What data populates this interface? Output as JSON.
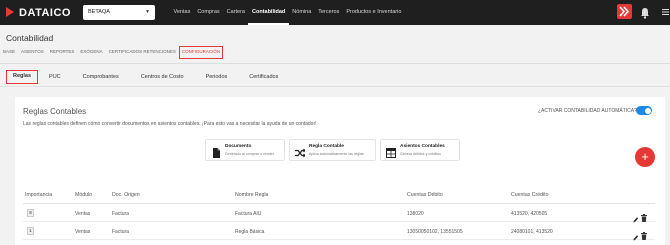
{
  "topbar": {
    "logo": "DATAICO",
    "company": "BETAQA",
    "nav": [
      "Ventas",
      "Compras",
      "Cartera",
      "Contabilidad",
      "Nómina",
      "Terceros",
      "Productos e Inventario"
    ],
    "active_index": 3,
    "icons": {
      "brand": "chevrons-right-icon",
      "bell": "bell-icon",
      "menu": "kebab-menu-icon"
    }
  },
  "page": {
    "title": "Contabilidad"
  },
  "subnav": [
    "BASE",
    "ASIENTOS",
    "REPORTES",
    "EXÓGENA",
    "CERTIFICADOS RETENCIONES",
    "CONFIGURACIÓN"
  ],
  "tabs": [
    "Reglas",
    "PUC",
    "Comprobantes",
    "Centros de Costo",
    "Periodos",
    "Certificados"
  ],
  "section": {
    "title": "Reglas Contables",
    "description": "Las reglas contables definen cómo convertir documentos en asientos contables. ¡Para esto vas a necesitar la ayuda de un contador!",
    "auto_label": "¿ACTIVAR CONTABILIDAD AUTOMÁTICA?"
  },
  "actions": [
    {
      "title": "Documento",
      "subtitle": "Generado al comprar o vender",
      "icon": "document-icon"
    },
    {
      "title": "Regla Contable",
      "subtitle": "Aplica automáticamente las reglas",
      "icon": "shuffle-icon"
    },
    {
      "title": "Asientos Contables",
      "subtitle": "Genera débitos y créditos",
      "icon": "ledger-icon"
    }
  ],
  "table": {
    "headers": [
      "Importancia",
      "Módulo",
      "Doc. Origen",
      "Nombre Regla",
      "Cuentas Débito",
      "Cuentas Crédito"
    ],
    "rows": [
      {
        "importancia": "8",
        "modulo": "Ventas",
        "origen": "Factura",
        "nombre": "Factura AIU",
        "debito": "138020",
        "credito": "413520, 420505"
      },
      {
        "importancia": "1",
        "modulo": "Ventas",
        "origen": "Factura",
        "nombre": "Regla Básica",
        "debito": "13050050102, 13551505",
        "credito": "24080101, 413520"
      }
    ]
  },
  "colors": {
    "accent": "#e53935",
    "toggle": "#1e88e5",
    "topbar": "#1f1f1f"
  }
}
